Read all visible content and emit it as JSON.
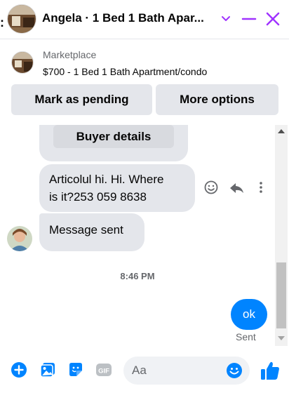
{
  "header": {
    "title": "Angela · 1 Bed 1 Bath Apar...",
    "fragment": ":"
  },
  "marketplace": {
    "source_label": "Marketplace",
    "listing_title": "$700 - 1 Bed 1 Bath Apartment/condo",
    "buttons": {
      "mark_pending": "Mark as pending",
      "more_options": "More options"
    }
  },
  "thread": {
    "buyer_details_label": "Buyer details",
    "messages": [
      {
        "sender": "Angela",
        "text_line1": "Articolul hi. Hi. Where",
        "text_line2": "is it?253 059 8638"
      },
      {
        "sender": "Angela",
        "text": "Message sent"
      }
    ],
    "timestamp": "8:46 PM",
    "outgoing": {
      "text": "ok",
      "status": "Sent"
    }
  },
  "composer": {
    "placeholder": "Aa",
    "icons": [
      "plus-icon",
      "photo-icon",
      "sticker-icon",
      "gif-icon",
      "emoji-icon",
      "like-icon"
    ]
  },
  "colors": {
    "accent": "#0084ff",
    "close_purple": "#a033ff",
    "bubble_gray": "#e4e6eb"
  }
}
